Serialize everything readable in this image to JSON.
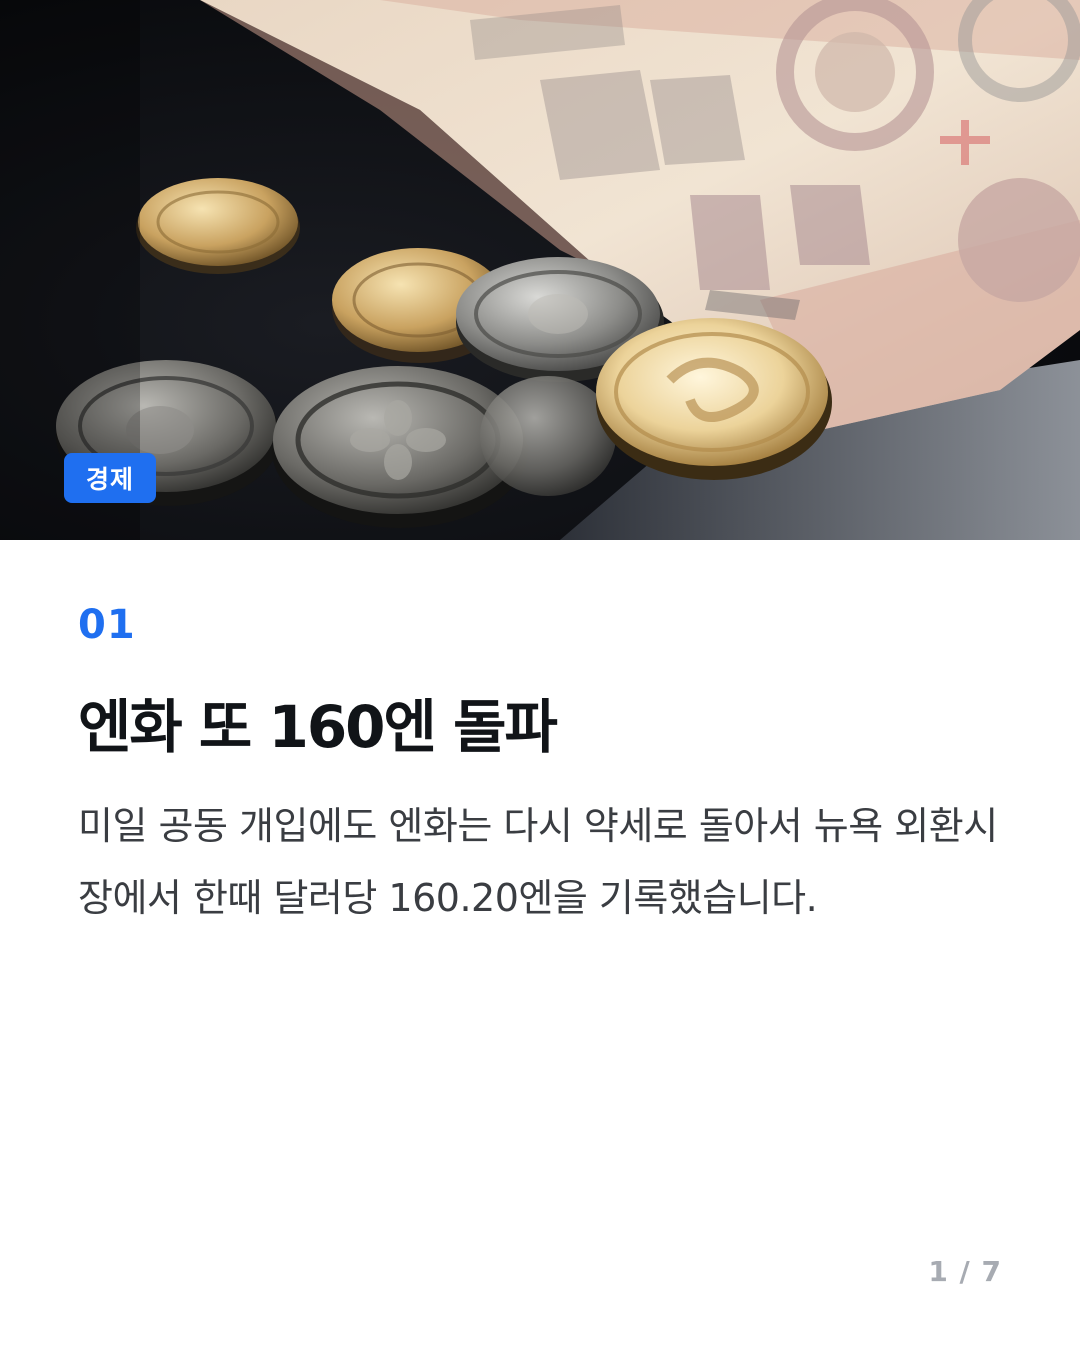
{
  "category": "경제",
  "item_number": "01",
  "headline": "엔화 또 160엔 돌파",
  "body": "미일 공동 개입에도 엔화는 다시 약세로 돌아서 뉴욕 외환시장에서 한때 달러당 160.20엔을 기록했습니다.",
  "pagination": "1 / 7",
  "colors": {
    "accent": "#1f6ff0",
    "headline": "#111418",
    "body": "#3a3d42",
    "muted": "#a7abb2"
  },
  "hero_image": {
    "subject": "coins-and-banknote-photo"
  }
}
